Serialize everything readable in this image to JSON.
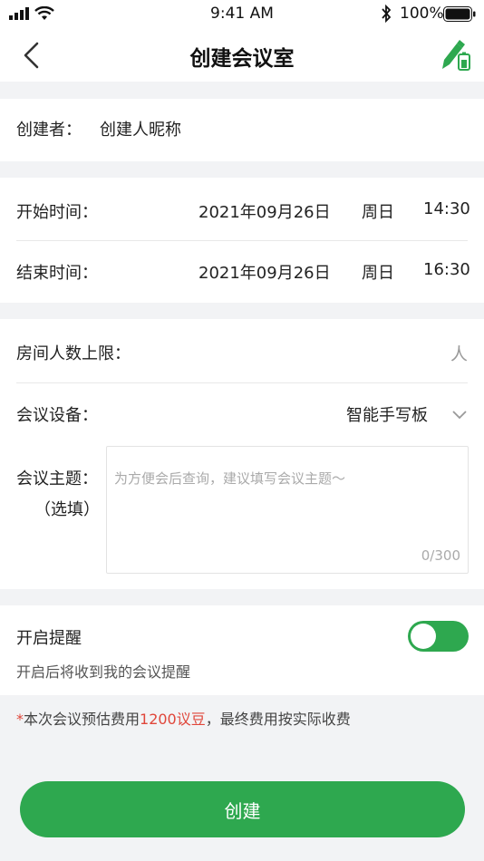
{
  "status_bar": {
    "time": "9:41 AM",
    "battery": "100%",
    "icons": [
      "signal-icon",
      "wifi-icon",
      "bluetooth-icon",
      "battery-icon"
    ]
  },
  "nav": {
    "title": "创建会议室",
    "back_icon": "chevron-left-icon",
    "action_icon": "pen-icon"
  },
  "creator": {
    "label": "创建者：",
    "value": "创建人昵称"
  },
  "schedule": {
    "start": {
      "label": "开始时间：",
      "date": "2021年09月26日",
      "weekday": "周日",
      "time": "14:30"
    },
    "end": {
      "label": "结束时间：",
      "date": "2021年09月26日",
      "weekday": "周日",
      "time": "16:30"
    }
  },
  "room": {
    "capacity_label": "房间人数上限：",
    "capacity_unit": "人",
    "device_label": "会议设备：",
    "device_value": "智能手写板",
    "topic_label": "会议主题：",
    "topic_optional": "（选填）",
    "topic_placeholder": "为方便会后查询，建议填写会议主题～",
    "topic_counter": "0/300"
  },
  "reminder": {
    "label": "开启提醒",
    "hint": "开启后将收到我的会议提醒",
    "enabled": true
  },
  "fee": {
    "star": "*",
    "prefix": "本次会议预估费用",
    "amount": "1200议豆",
    "suffix": "，最终费用按实际收费"
  },
  "actions": {
    "create_label": "创建"
  },
  "colors": {
    "primary": "#2ea84f",
    "accent": "#e0463a",
    "background": "#f2f3f5"
  }
}
